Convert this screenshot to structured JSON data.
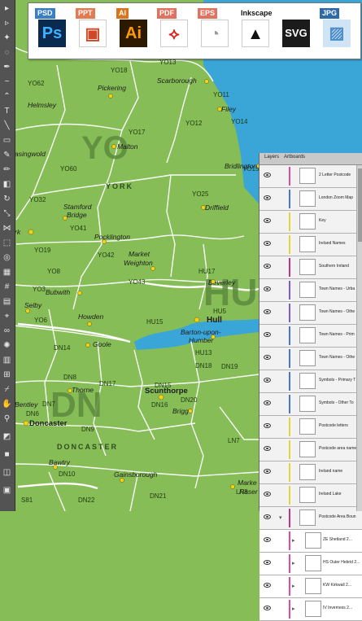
{
  "formats": [
    {
      "tab": "PSD",
      "tab_color": "#3a7fc4",
      "tile_bg": "#0b2a4f",
      "tile_fg": "#3db2ff",
      "tile_text": "Ps",
      "icon": "photoshop-icon"
    },
    {
      "tab": "PPT",
      "tab_color": "#e27a54",
      "tile_bg": "#ffffff",
      "tile_fg": "#d24726",
      "tile_text": "",
      "icon": "powerpoint-icon"
    },
    {
      "tab": "AI",
      "tab_color": "#d9731c",
      "tile_bg": "#2d1900",
      "tile_fg": "#ff9a00",
      "tile_text": "Ai",
      "icon": "illustrator-icon"
    },
    {
      "tab": "PDF",
      "tab_color": "#e0735f",
      "tile_bg": "#ffffff",
      "tile_fg": "#d7261c",
      "tile_text": "",
      "icon": "pdf-icon"
    },
    {
      "tab": "EPS",
      "tab_color": "#e0735f",
      "tile_bg": "#ffffff",
      "tile_fg": "#9a9a9a",
      "tile_text": "",
      "icon": "eps-icon"
    },
    {
      "tab": "Inkscape",
      "tab_color": "#ffffff",
      "tile_bg": "#ffffff",
      "tile_fg": "#111111",
      "tile_text": "",
      "icon": "inkscape-icon"
    },
    {
      "tab": "",
      "tab_color": "#ffffff",
      "tile_bg": "#1b1b1b",
      "tile_fg": "#ffffff",
      "tile_text": "SVG",
      "icon": "svg-icon"
    },
    {
      "tab": "JPG",
      "tab_color": "#2f6aa8",
      "tile_bg": "#cfe4f5",
      "tile_fg": "#4a8bc9",
      "tile_text": "",
      "icon": "jpg-icon"
    }
  ],
  "map": {
    "areas": [
      "YO",
      "HU",
      "DN"
    ],
    "region_names": [
      "YORK",
      "DONCASTER"
    ],
    "districts": [
      "YO13",
      "YO18",
      "YO62",
      "YO11",
      "YO12",
      "YO17",
      "YO14",
      "YO60",
      "YO15",
      "YO32",
      "YO25",
      "YO41",
      "YO42",
      "YO43",
      "HU17",
      "YO8",
      "YO19",
      "YO3",
      "HU15",
      "HU5",
      "DN14",
      "HU13",
      "DN18",
      "DN19",
      "DN8",
      "DN17",
      "DN15",
      "DN16",
      "DN20",
      "DN7",
      "DN6",
      "DN9",
      "DN10",
      "DN22",
      "DN21",
      "LN7",
      "LN8",
      "S81"
    ],
    "towns": [
      "Scarborough",
      "Pickering",
      "Helmsley",
      "Filey",
      "Malton",
      "Bridlington",
      "Stamford Bridge",
      "Driffield",
      "Pocklington",
      "Market Weighton",
      "Beverley",
      "Bubwith",
      "Howden",
      "Selby",
      "Hull",
      "Barton-upon-Humber",
      "Goole",
      "Scunthorpe",
      "Brigg",
      "Thorne",
      "Bentley",
      "Doncaster",
      "Bawtry",
      "Gainsborough",
      "Market Rasen",
      "Knaresborough",
      "York"
    ]
  },
  "layers_panel": {
    "tabs": [
      "Layers",
      "Artboards"
    ],
    "rows": [
      {
        "name": "2 Letter Postcode",
        "color": "#e04b9c"
      },
      {
        "name": "London Zoom Map",
        "color": "#4a73d6"
      },
      {
        "name": "Key",
        "color": "#e2d43a"
      },
      {
        "name": "Ireland Names",
        "color": "#e2d43a"
      },
      {
        "name": "Southern Ireland",
        "color": "#c1338a"
      },
      {
        "name": "Town Names - Urba",
        "color": "#7a5ad9"
      },
      {
        "name": "Town Names - Othe",
        "color": "#7a5ad9"
      },
      {
        "name": "Town Names - Prim",
        "color": "#4a73d6"
      },
      {
        "name": "Town Names - Othe",
        "color": "#4a73d6"
      },
      {
        "name": "Symbols - Primary T",
        "color": "#4a73d6"
      },
      {
        "name": "Symbols - Other To",
        "color": "#4a73d6"
      },
      {
        "name": "Postcode letters",
        "color": "#e2d43a"
      },
      {
        "name": "Postcode area name",
        "color": "#e2d43a"
      },
      {
        "name": "Ireland name",
        "color": "#e2d43a"
      },
      {
        "name": "Ireland Lake",
        "color": "#e2d43a"
      },
      {
        "name": "Postcode Area Boun",
        "color": "#c1338a"
      },
      {
        "name": "ZE Shetland 2...",
        "color": "#e04b9c"
      },
      {
        "name": "HS Outer Hebrid 2...",
        "color": "#e04b9c"
      },
      {
        "name": "KW Kirkwall 2...",
        "color": "#e04b9c"
      },
      {
        "name": "IV Inverness 2...",
        "color": "#e04b9c"
      }
    ]
  }
}
